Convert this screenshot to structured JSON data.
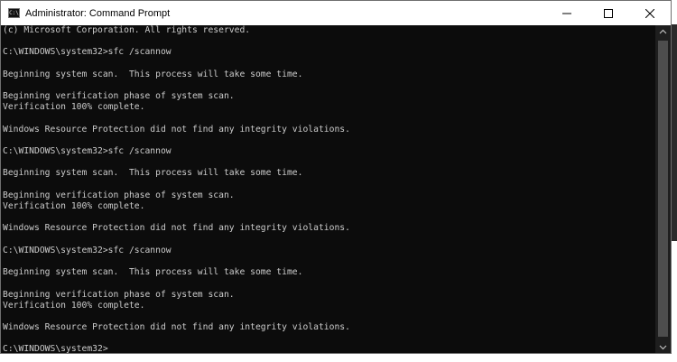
{
  "window": {
    "title": "Administrator: Command Prompt"
  },
  "controls": {
    "minimize": "minimize-icon",
    "maximize": "maximize-icon",
    "close": "close-icon"
  },
  "console": {
    "lines": [
      "(c) Microsoft Corporation. All rights reserved.",
      "",
      "C:\\WINDOWS\\system32>sfc /scannow",
      "",
      "Beginning system scan.  This process will take some time.",
      "",
      "Beginning verification phase of system scan.",
      "Verification 100% complete.",
      "",
      "Windows Resource Protection did not find any integrity violations.",
      "",
      "C:\\WINDOWS\\system32>sfc /scannow",
      "",
      "Beginning system scan.  This process will take some time.",
      "",
      "Beginning verification phase of system scan.",
      "Verification 100% complete.",
      "",
      "Windows Resource Protection did not find any integrity violations.",
      "",
      "C:\\WINDOWS\\system32>sfc /scannow",
      "",
      "Beginning system scan.  This process will take some time.",
      "",
      "Beginning verification phase of system scan.",
      "Verification 100% complete.",
      "",
      "Windows Resource Protection did not find any integrity violations.",
      "",
      "C:\\WINDOWS\\system32>"
    ],
    "text_color": "#cccccc",
    "background_color": "#0c0c0c"
  }
}
